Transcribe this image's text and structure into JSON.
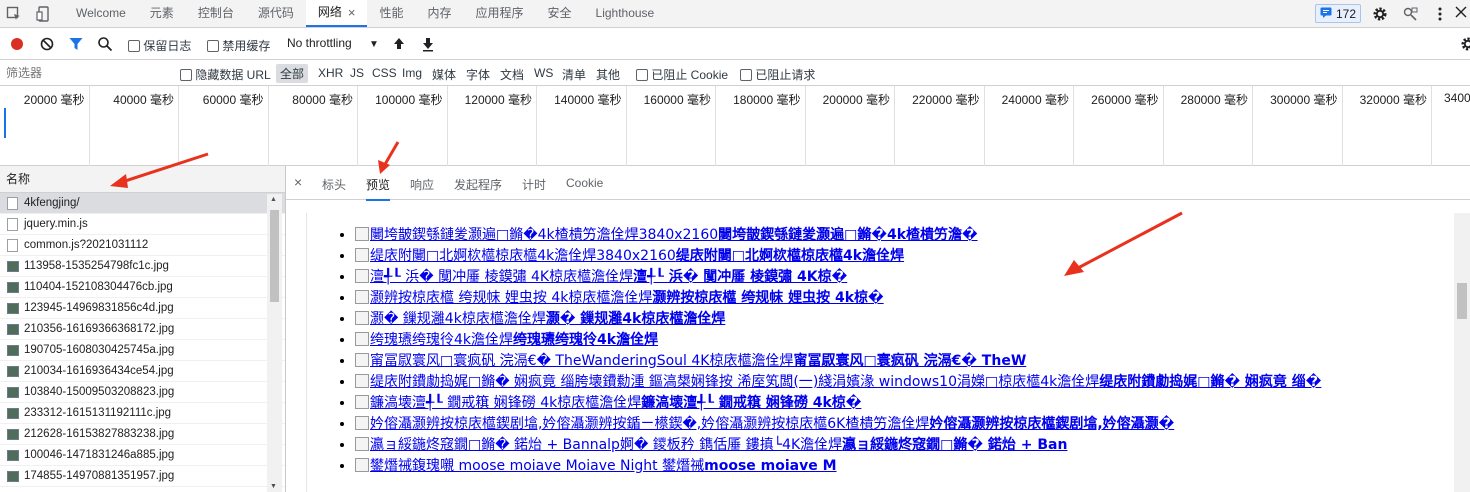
{
  "tabs": [
    {
      "label": "Welcome"
    },
    {
      "label": "元素"
    },
    {
      "label": "控制台"
    },
    {
      "label": "源代码"
    },
    {
      "label": "网络",
      "active": true
    },
    {
      "label": "性能"
    },
    {
      "label": "内存"
    },
    {
      "label": "应用程序"
    },
    {
      "label": "安全"
    },
    {
      "label": "Lighthouse"
    }
  ],
  "messages_count": "172",
  "toolbar": {
    "preserve_log": "保留日志",
    "disable_cache": "禁用缓存",
    "throttling": "No throttling"
  },
  "filter": {
    "placeholder": "筛选器",
    "hide_data_urls": "隐藏数据 URL",
    "types": [
      "全部",
      "XHR",
      "JS",
      "CSS",
      "Img",
      "媒体",
      "字体",
      "文档",
      "WS",
      "清单",
      "其他"
    ],
    "blocked_cookies": "已阻止 Cookie",
    "blocked_requests": "已阻止请求"
  },
  "timeline_ticks": [
    "20000 毫秒",
    "40000 毫秒",
    "60000 毫秒",
    "80000 毫秒",
    "100000 毫秒",
    "120000 毫秒",
    "140000 毫秒",
    "160000 毫秒",
    "180000 毫秒",
    "200000 毫秒",
    "220000 毫秒",
    "240000 毫秒",
    "260000 毫秒",
    "280000 毫秒",
    "300000 毫秒",
    "320000 毫秒",
    "3400"
  ],
  "request_list": {
    "header": "名称",
    "items": [
      {
        "name": "4kfengjing/",
        "kind": "doc"
      },
      {
        "name": "jquery.min.js",
        "kind": "doc"
      },
      {
        "name": "common.js?2021031112",
        "kind": "doc"
      },
      {
        "name": "113958-1535254798fc1c.jpg",
        "kind": "img"
      },
      {
        "name": "110404-152108304476cb.jpg",
        "kind": "img"
      },
      {
        "name": "123945-14969831856c4d.jpg",
        "kind": "img"
      },
      {
        "name": "210356-16169366368172.jpg",
        "kind": "img"
      },
      {
        "name": "190705-1608030425745a.jpg",
        "kind": "img"
      },
      {
        "name": "210034-1616936434ce54.jpg",
        "kind": "img"
      },
      {
        "name": "103840-15009503208823.jpg",
        "kind": "img"
      },
      {
        "name": "233312-1615131192111c.jpg",
        "kind": "img"
      },
      {
        "name": "212628-16153827883238.jpg",
        "kind": "img"
      },
      {
        "name": "100046-1471831246a885.jpg",
        "kind": "img"
      },
      {
        "name": "174855-14970881351957.jpg",
        "kind": "img"
      }
    ]
  },
  "detail_tabs": [
    {
      "label": "标头"
    },
    {
      "label": "预览",
      "active": true
    },
    {
      "label": "响应"
    },
    {
      "label": "发起程序"
    },
    {
      "label": "计时"
    },
    {
      "label": "Cookie"
    }
  ],
  "preview_items": [
    {
      "alt": "闄垮皵鍥綔鏈夎灏遍□鏅�4k楂樻竻澹佺焊3840x2160",
      "bold": "闄垮皵鍥綔鏈夎灏遍□鏅�4k楂樻竻澹�"
    },
    {
      "alt": "缇庡附闄□北婀栨櫙椋庡櫙4k澹佺焊3840x2160",
      "bold": "缇庡附闄□北婀栨櫙椋庡櫙4k澹佺焊"
    },
    {
      "alt": "澶╃┖ 浜� 闃冲厜 棱鏌彇 4K椋庡櫙澹佺焊",
      "bold": "澶╃┖ 浜� 闃冲厜 棱鏌彇 4K椋�"
    },
    {
      "alt": "灏辨按椋庡櫙 绔规帓 娌虫按 4k椋庡櫙澹佺焊",
      "bold": "灏辨按椋庡櫙 绔规帓 娌虫按 4k椋�"
    },
    {
      "alt": "灏� 鏁规灉4k椋庡櫙澹佺焊",
      "bold": "灏� 鏁规灉4k椋庡櫙澹佺焊"
    },
    {
      "alt": "绔瑰瓙绔瑰彾4k澹佺焊",
      "bold": "绔瑰瓙绔瑰彾4k澹佺焊"
    },
    {
      "alt": "甯冨叞寰风□寰疯矾 浣滆€� TheWanderingSoul 4K椋庡櫙澹佺焊",
      "bold": "甯冨叞寰风□寰疯矾 浣滆€� TheW"
    },
    {
      "alt": "缇庡附鐨勮捣娓□鏅� 娴疯竟 缁胯壊鐨勬湩 鏂滈槼娴锋按 浠庢笂闆(一)綫涓嬪湪 windows10涓嬫□椋庡櫙4k澹佺焊",
      "bold": "缇庡附鐨勮捣娓□鏅� 娴疯竟 缁�",
      "wrap": true
    },
    {
      "alt": "鐮滈壊澶╃┖ 鐗戒簯 娴锋磱 4k椋庡櫙澹佺焊",
      "bold": "鐮滈壊澶╃┖ 鐗戒簯 娴锋磱 4k椋�"
    },
    {
      "alt": "妗傛灄灏辨按椋庡櫙鍥剧墖,妗傛灄灏辨按鍎ㄧ櫒鍥�,妗傛灄灏辨按椋庡櫙6K楂樻竻澹佺焊",
      "bold": "妗傛灄灏辨按椋庡櫙鍥剧墖,妗傛灄灏�"
    },
    {
      "alt": "瀛ョ綏鍦炵窛鐗□鏅� 鍩炲 + Bannalp婀� 鑁板矜 鐫佸厜 鏤搷└4K澹佺焊",
      "bold": "瀛ョ綏鍦炵窛鐗□鏅� 鍩炲 + Ban"
    },
    {
      "alt": "鐢熸祴鍑瑰嚫 moose moiave Moiave Night 鐢熸祴",
      "bold": "moose moiave M"
    }
  ],
  "colors": {
    "accent": "#1a73e8",
    "record": "#d93025",
    "link": "#0000ee",
    "arrow": "#e8321e"
  }
}
